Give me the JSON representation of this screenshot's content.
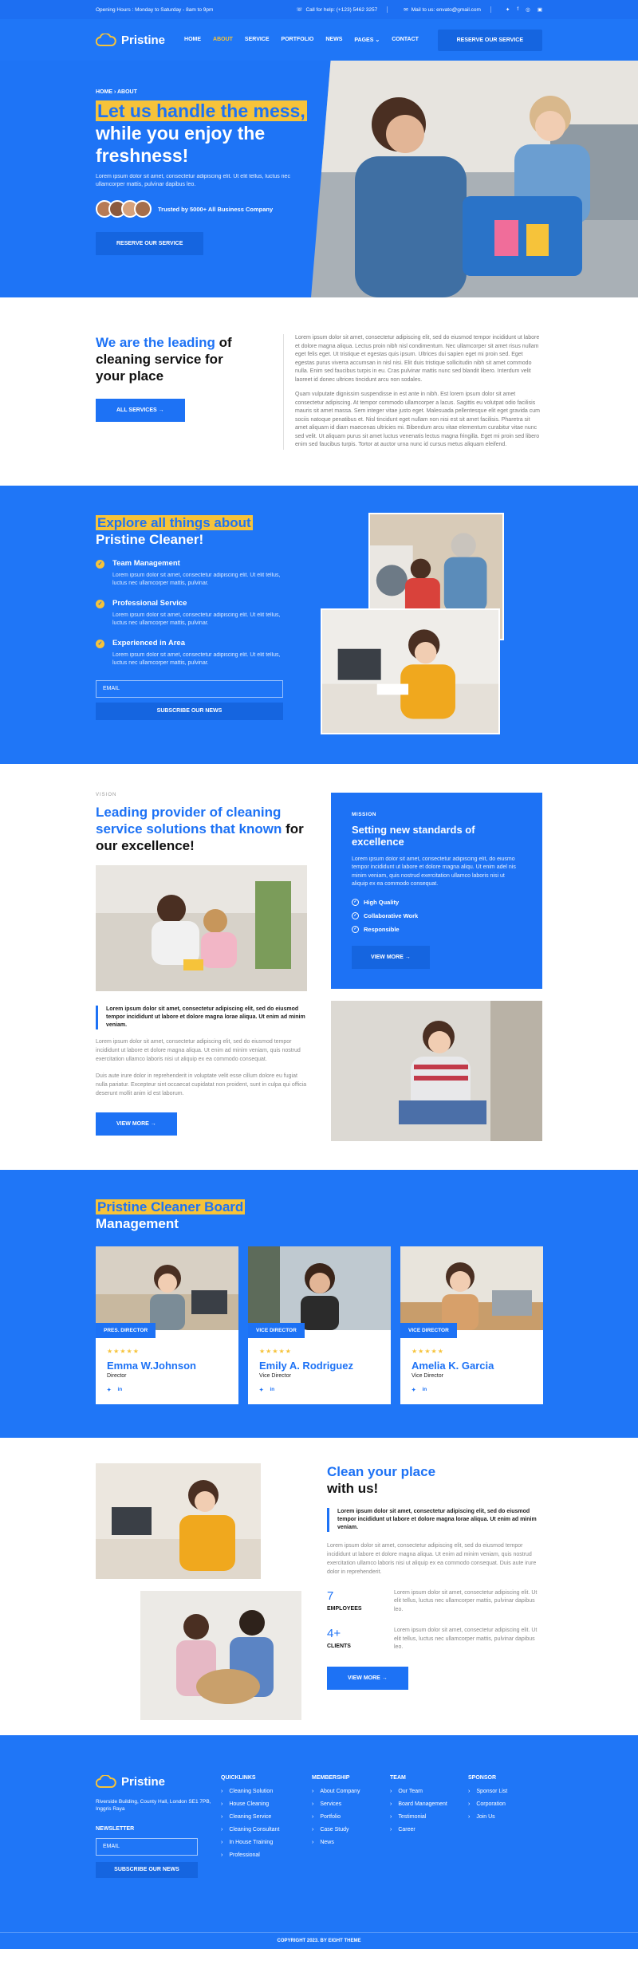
{
  "topbar": {
    "hours": "Opening Hours : Monday to Saturday - 8am to 9pm",
    "phone": "Call for help: (+123) 5462 3257",
    "mail": "Mail to us: envato@gmail.com",
    "social": [
      "t-icon",
      "f-icon",
      "ig-icon",
      "in-icon"
    ]
  },
  "nav": {
    "brand": "Pristine",
    "items": [
      "HOME",
      "ABOUT",
      "SERVICE",
      "PORTFOLIO",
      "NEWS",
      "PAGES",
      "CONTACT"
    ],
    "cta": "RESERVE OUR SERVICE"
  },
  "hero": {
    "crumb": "HOME › ABOUT",
    "title_highlight": "Let us handle the mess,",
    "title_rest": "while you enjoy the freshness!",
    "body": "Lorem ipsum dolor sit amet, consectetur adipiscing elit. Ut elit tellus, luctus nec ullamcorper mattis, pulvinar dapibus leo.",
    "trust": "Trusted by 5000+ All Business Company",
    "cta": "RESERVE OUR SERVICE"
  },
  "about": {
    "title_blue": "We are the leading",
    "title_rest": " of cleaning service for your place",
    "btn": "ALL SERVICES →",
    "p1": "Lorem ipsum dolor sit amet, consectetur adipiscing elit, sed do eiusmod tempor incididunt ut labore et dolore magna aliqua. Lectus proin nibh nisl condimentum. Nec ullamcorper sit amet risus nullam eget felis eget. Ut tristique et egestas quis ipsum. Ultrices dui sapien eget mi proin sed. Eget egestas purus viverra accumsan in nisl nisi. Elit duis tristique sollicitudin nibh sit amet commodo nulla. Enim sed faucibus turpis in eu. Cras pulvinar mattis nunc sed blandit libero. Interdum velit laoreet id donec ultrices tincidunt arcu non sodales.",
    "p2": "Quam vulputate dignissim suspendisse in est ante in nibh. Est lorem ipsum dolor sit amet consectetur adipiscing. At tempor commodo ullamcorper a lacus. Sagittis eu volutpat odio facilisis mauris sit amet massa. Sem integer vitae justo eget. Malesuada pellentesque elit eget gravida cum sociis natoque penatibus et. Nisl tincidunt eget nullam non nisi est sit amet facilisis. Pharetra sit amet aliquam id diam maecenas ultricies mi. Bibendum arcu vitae elementum curabitur vitae nunc sed velit. Ut aliquam purus sit amet luctus venenatis lectus magna fringilla. Eget mi proin sed libero enim sed faucibus turpis. Tortor at auctor urna nunc id cursus metus aliquam eleifend."
  },
  "explore": {
    "title_highlight": "Explore all things about",
    "title_rest": "Pristine Cleaner!",
    "features": [
      {
        "title": "Team Management",
        "text": "Lorem ipsum dolor sit amet, consectetur adipiscing elit. Ut elit tellus, luctus nec ullamcorper mattis, pulvinar."
      },
      {
        "title": "Professional Service",
        "text": "Lorem ipsum dolor sit amet, consectetur adipiscing elit. Ut elit tellus, luctus nec ullamcorper mattis, pulvinar."
      },
      {
        "title": "Experienced in Area",
        "text": "Lorem ipsum dolor sit amet, consectetur adipiscing elit. Ut elit tellus, luctus nec ullamcorper mattis, pulvinar."
      }
    ],
    "email_placeholder": "EMAIL",
    "subscribe": "SUBSCRIBE OUR NEWS"
  },
  "vision": {
    "kicker": "VISION",
    "title_blue": "Leading provider of cleaning service solutions that known",
    "title_rest": "for our excellence!",
    "quote": "Lorem ipsum dolor sit amet, consectetur adipiscing elit, sed do eiusmod tempor incididunt ut labore et dolore magna lorae aliqua. Ut enim ad minim veniam.",
    "p1": "Lorem ipsum dolor sit amet, consectetur adipiscing elit, sed do eiusmod tempor incididunt ut labore et dolore magna aliqua. Ut enim ad minim veniam, quis nostrud exercitation ullamco laboris nisi ut aliquip ex ea commodo consequat.",
    "p2": "Duis aute irure dolor in reprehenderit in voluptate velit esse cillum dolore eu fugiat nulla pariatur. Excepteur sint occaecat cupidatat non proident, sunt in culpa qui officia deserunt mollit anim id est laborum.",
    "btn": "VIEW MORE →"
  },
  "mission": {
    "tag": "MISSION",
    "title": "Setting new standards of excellence",
    "text": "Lorem ipsum dolor sit amet, consectetur adipiscing elit, do eiusmo tempor incididunt ut labore et dolore magna aliqu. Ut enim adel nis minim veniam, quis nostrud exercitation ullamco laboris nisi ut aliquip ex ea commodo consequat.",
    "items": [
      "High Quality",
      "Collaborative Work",
      "Responsible"
    ],
    "btn": "VIEW MORE →"
  },
  "board": {
    "title_highlight": "Pristine Cleaner Board",
    "title_rest": "Management",
    "members": [
      {
        "pos": "PRES. DIRECTOR",
        "name": "Emma W.Johnson",
        "role": "Director"
      },
      {
        "pos": "VICE DIRECTOR",
        "name": "Emily A. Rodriguez",
        "role": "Vice Director"
      },
      {
        "pos": "VICE DIRECTOR",
        "name": "Amelia K. Garcia",
        "role": "Vice Director"
      }
    ],
    "stars": "★★★★★",
    "social": [
      "t",
      "in"
    ]
  },
  "clean": {
    "title_blue": "Clean your place",
    "title_rest": "with us!",
    "quote": "Lorem ipsum dolor sit amet, consectetur adipiscing elit, sed do eiusmod tempor incididunt ut labore et dolore magna lorae aliqua. Ut enim ad minim veniam.",
    "text": "Lorem ipsum dolor sit amet, consectetur adipiscing elit, sed do eiusmod tempor incididunt ut labore et dolore magna aliqua. Ut enim ad minim veniam, quis nostrud exercitation ullamco laboris nisi ut aliquip ex ea commodo consequat. Duis aute irure dolor in reprehenderit.",
    "stats": [
      {
        "num": "7",
        "label": "EMPLOYEES",
        "text": "Lorem ipsum dolor sit amet, consectetur adipiscing elit. Ut elit tellus, luctus nec ullamcorper mattis, pulvinar dapibus leo."
      },
      {
        "num": "4+",
        "label": "CLIENTS",
        "text": "Lorem ipsum dolor sit amet, consectetur adipiscing elit. Ut elit tellus, luctus nec ullamcorper mattis, pulvinar dapibus leo."
      }
    ],
    "btn": "VIEW MORE →"
  },
  "footer": {
    "brand": "Pristine",
    "address": "Riverside Building, County Hall, London SE1 7PB, Inggris Raya",
    "newsletter": "NEWSLETTER",
    "email_placeholder": "EMAIL",
    "subscribe": "SUBSCRIBE OUR NEWS",
    "columns": [
      {
        "title": "QUICKLINKS",
        "links": [
          "Cleaning Solution",
          "House Cleaning",
          "Cleaning Service",
          "Cleaning Consultant",
          "In House Training",
          "Professional"
        ]
      },
      {
        "title": "MEMBERSHIP",
        "links": [
          "About Company",
          "Services",
          "Portfolio",
          "Case Study",
          "News"
        ]
      },
      {
        "title": "TEAM",
        "links": [
          "Our Team",
          "Board Management",
          "Testimonial",
          "Career"
        ]
      },
      {
        "title": "SPONSOR",
        "links": [
          "Sponsor List",
          "Corporation",
          "Join Us"
        ]
      }
    ],
    "copyright": "COPYRIGHT 2023. BY EIGHT THEME"
  },
  "colors": {
    "primary": "#1d72f5",
    "accent": "#f6c33a"
  }
}
